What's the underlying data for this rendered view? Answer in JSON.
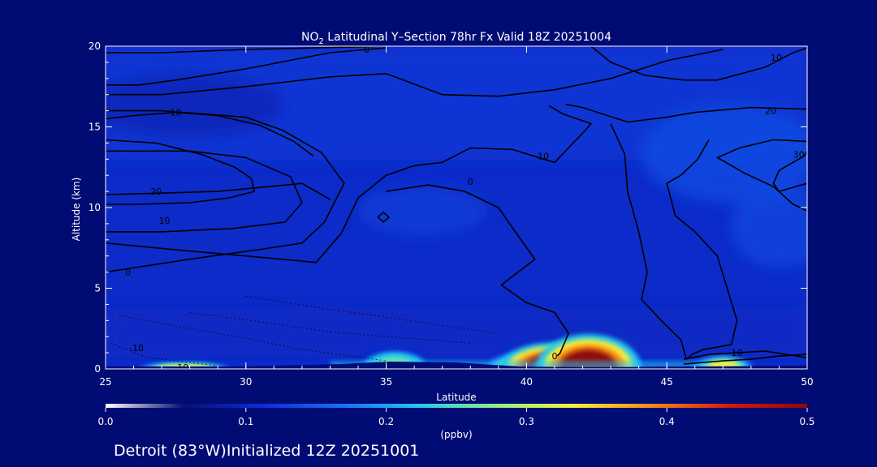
{
  "chart_data": {
    "type": "heatmap",
    "title_prefix": "NO",
    "title_subscript": "2",
    "title_suffix": " Latitudinal Y–Section 78hr  Fx Valid 18Z 20251004",
    "xlabel": "Latitude",
    "ylabel": "Altitude (km)",
    "xlim": [
      25,
      50
    ],
    "ylim": [
      0,
      20
    ],
    "x_ticks": [
      "25",
      "30",
      "35",
      "40",
      "45",
      "50"
    ],
    "y_ticks": [
      "0",
      "5",
      "10",
      "15",
      "20"
    ],
    "colorbar": {
      "label": "(ppbv)",
      "range": [
        0.0,
        0.5
      ],
      "ticks": [
        "0.0",
        "0.1",
        "0.2",
        "0.3",
        "0.4",
        "0.5"
      ],
      "colors": [
        "#ffffff",
        "#08106e",
        "#0c2bd6",
        "#1a6cf5",
        "#23c6f0",
        "#8cf08a",
        "#f7f03a",
        "#f58a17",
        "#d41a0c",
        "#8e0808"
      ]
    },
    "high_concentration_regions": [
      {
        "lat_center": 27.8,
        "lat_halfwidth": 1.2,
        "alt_top_km": 0.3,
        "peak_ppbv": 0.35
      },
      {
        "lat_center": 35.3,
        "lat_halfwidth": 1.0,
        "alt_top_km": 0.9,
        "peak_ppbv": 0.3
      },
      {
        "lat_center": 39.6,
        "lat_halfwidth": 0.9,
        "alt_top_km": 0.8,
        "peak_ppbv": 0.25
      },
      {
        "lat_center": 40.9,
        "lat_halfwidth": 1.4,
        "alt_top_km": 1.2,
        "peak_ppbv": 0.5
      },
      {
        "lat_center": 42.2,
        "lat_halfwidth": 1.4,
        "alt_top_km": 1.6,
        "peak_ppbv": 0.5
      },
      {
        "lat_center": 47.0,
        "lat_halfwidth": 0.8,
        "alt_top_km": 0.6,
        "peak_ppbv": 0.35
      }
    ],
    "contours": [
      {
        "points": [
          [
            25,
            19.6
          ],
          [
            27,
            19.6
          ],
          [
            30,
            19.8
          ],
          [
            35,
            20
          ]
        ]
      },
      {
        "points": [
          [
            25,
            17.6
          ],
          [
            26.2,
            17.6
          ],
          [
            27.5,
            17.9
          ],
          [
            30,
            18.6
          ],
          [
            33,
            19.6
          ],
          [
            35,
            19.9
          ]
        ]
      },
      {
        "points": [
          [
            25,
            17.0
          ],
          [
            27,
            17.0
          ],
          [
            30,
            17.5
          ],
          [
            33,
            18.1
          ],
          [
            35,
            18.3
          ],
          [
            37,
            17.0
          ],
          [
            39,
            16.9
          ],
          [
            41,
            17.3
          ],
          [
            43,
            18.0
          ],
          [
            45,
            19.1
          ],
          [
            47,
            19.8
          ]
        ]
      },
      {
        "points": [
          [
            25,
            15.5
          ],
          [
            26,
            15.7
          ],
          [
            27.5,
            15.9
          ],
          [
            29,
            15.7
          ],
          [
            30.5,
            15.1
          ],
          [
            31.7,
            14.1
          ],
          [
            32.4,
            13.2
          ]
        ]
      },
      {
        "points": [
          [
            25,
            14.2
          ],
          [
            26.8,
            14.0
          ],
          [
            28.4,
            13.3
          ],
          [
            29.6,
            12.5
          ],
          [
            30.2,
            11.8
          ],
          [
            30.3,
            11.0
          ],
          [
            29.4,
            10.6
          ],
          [
            28,
            10.3
          ],
          [
            26.2,
            10.2
          ],
          [
            25,
            10.2
          ]
        ]
      },
      {
        "points": [
          [
            25,
            13.5
          ],
          [
            28,
            13.5
          ],
          [
            30,
            13.1
          ],
          [
            31.6,
            11.9
          ],
          [
            32,
            10.3
          ],
          [
            31.4,
            9.1
          ],
          [
            29.5,
            8.7
          ],
          [
            27,
            8.5
          ],
          [
            25,
            8.5
          ]
        ]
      },
      {
        "points": [
          [
            25,
            16.0
          ],
          [
            27,
            16.0
          ],
          [
            30,
            15.6
          ],
          [
            31.3,
            14.8
          ],
          [
            32.7,
            13.4
          ],
          [
            33.5,
            11.5
          ],
          [
            32.8,
            9.1
          ],
          [
            32,
            7.8
          ],
          [
            30.5,
            7.4
          ],
          [
            28,
            6.8
          ],
          [
            25,
            6.0
          ]
        ]
      },
      {
        "points": [
          [
            25,
            7.8
          ],
          [
            28,
            7.3
          ],
          [
            30,
            7.0
          ],
          [
            32.5,
            6.6
          ],
          [
            33.4,
            8.4
          ],
          [
            34.0,
            10.6
          ],
          [
            35.0,
            12.0
          ],
          [
            36.0,
            12.6
          ],
          [
            37.0,
            12.8
          ],
          [
            38.0,
            13.7
          ],
          [
            39.5,
            13.6
          ],
          [
            41.0,
            12.8
          ],
          [
            42.1,
            14.8
          ],
          [
            42.3,
            15.2
          ],
          [
            41.3,
            15.8
          ],
          [
            40.8,
            16.3
          ]
        ]
      },
      {
        "points": [
          [
            34.7,
            9.4
          ],
          [
            34.9,
            9.1
          ],
          [
            35.1,
            9.4
          ],
          [
            34.9,
            9.7
          ],
          [
            34.7,
            9.4
          ]
        ]
      },
      {
        "points": [
          [
            35,
            11.0
          ],
          [
            36.5,
            11.4
          ],
          [
            37.8,
            11.0
          ],
          [
            39.0,
            10.0
          ],
          [
            39.6,
            8.5
          ],
          [
            40.3,
            6.8
          ],
          [
            39.1,
            5.2
          ],
          [
            40.0,
            4.1
          ],
          [
            41.0,
            3.5
          ],
          [
            41.5,
            2.2
          ],
          [
            41.2,
            1.0
          ],
          [
            41.1,
            0.8
          ]
        ]
      },
      {
        "points": [
          [
            42.3,
            20.0
          ],
          [
            43.0,
            19.0
          ],
          [
            44.2,
            18.2
          ],
          [
            45.6,
            17.9
          ],
          [
            46.8,
            17.9
          ],
          [
            48.5,
            18.7
          ],
          [
            49.5,
            19.6
          ],
          [
            50,
            19.9
          ]
        ]
      },
      {
        "points": [
          [
            43,
            15.2
          ],
          [
            43.5,
            13.3
          ],
          [
            43.6,
            11.0
          ],
          [
            44.0,
            8.5
          ],
          [
            44.3,
            6.0
          ],
          [
            44.1,
            4.3
          ],
          [
            44.8,
            3.0
          ],
          [
            45.5,
            1.8
          ],
          [
            45.7,
            0.6
          ]
        ]
      },
      {
        "points": [
          [
            41.4,
            16.4
          ],
          [
            42.0,
            16.2
          ],
          [
            43.6,
            15.3
          ],
          [
            45.0,
            15.6
          ],
          [
            46.0,
            15.9
          ],
          [
            48.0,
            16.2
          ],
          [
            50,
            16.1
          ]
        ]
      },
      {
        "points": [
          [
            46.5,
            14.2
          ],
          [
            46.1,
            13.0
          ],
          [
            45.5,
            12.0
          ],
          [
            45.0,
            11.5
          ],
          [
            45.3,
            9.5
          ],
          [
            46.0,
            8.5
          ],
          [
            46.8,
            7.0
          ],
          [
            47.5,
            3.0
          ],
          [
            47.3,
            1.5
          ],
          [
            46.3,
            1.2
          ],
          [
            45.9,
            0.9
          ],
          [
            45.7,
            0.6
          ]
        ]
      },
      {
        "points": [
          [
            50,
            14.1
          ],
          [
            48.8,
            14.2
          ],
          [
            47.6,
            13.7
          ],
          [
            46.8,
            13.1
          ],
          [
            47.8,
            12.1
          ],
          [
            48.8,
            11.3
          ],
          [
            49.5,
            10.2
          ],
          [
            50,
            9.8
          ]
        ]
      },
      {
        "points": [
          [
            50,
            11.5
          ],
          [
            49.0,
            11.0
          ],
          [
            48.8,
            11.5
          ],
          [
            49.0,
            12.3
          ],
          [
            49.9,
            13.2
          ],
          [
            50,
            13.5
          ]
        ]
      },
      {
        "points": [
          [
            25,
            10.8
          ],
          [
            29,
            11.0
          ],
          [
            32,
            11.5
          ],
          [
            33,
            10.5
          ]
        ]
      },
      {
        "points": [
          [
            45.6,
            0.6
          ],
          [
            46.5,
            0.9
          ],
          [
            47.5,
            1.0
          ],
          [
            48.5,
            1.1
          ],
          [
            50,
            0.7
          ]
        ]
      },
      {
        "points": [
          [
            45.6,
            0.3
          ],
          [
            47,
            0.5
          ],
          [
            48,
            0.6
          ],
          [
            49,
            0.8
          ],
          [
            50,
            0.9
          ]
        ]
      }
    ],
    "contour_labels": [
      {
        "x": 34.3,
        "y": 19.8,
        "text": "0"
      },
      {
        "x": 48.9,
        "y": 19.3,
        "text": "10"
      },
      {
        "x": 27.5,
        "y": 15.9,
        "text": "10"
      },
      {
        "x": 48.7,
        "y": 16.0,
        "text": "20"
      },
      {
        "x": 49.7,
        "y": 13.3,
        "text": "30"
      },
      {
        "x": 26.8,
        "y": 11.0,
        "text": "20"
      },
      {
        "x": 27.1,
        "y": 9.2,
        "text": "10"
      },
      {
        "x": 38.0,
        "y": 11.6,
        "text": "0"
      },
      {
        "x": 40.6,
        "y": 13.2,
        "text": "10"
      },
      {
        "x": 25.8,
        "y": 6.0,
        "text": "0"
      },
      {
        "x": 26.1,
        "y": 1.3,
        "text": "-10"
      },
      {
        "x": 27.7,
        "y": 0.1,
        "text": "-10"
      },
      {
        "x": 47.5,
        "y": 1.0,
        "text": "10"
      },
      {
        "x": 41.0,
        "y": 0.8,
        "text": "0"
      }
    ],
    "dashed_contours": [
      {
        "points": [
          [
            25.2,
            1.6
          ],
          [
            26.5,
            0.7
          ],
          [
            28.0,
            0.4
          ],
          [
            29.0,
            0.2
          ]
        ]
      },
      {
        "points": [
          [
            25.5,
            3.3
          ],
          [
            28.0,
            2.5
          ],
          [
            30.0,
            1.9
          ],
          [
            32.0,
            1.2
          ],
          [
            35.0,
            0.5
          ]
        ]
      },
      {
        "points": [
          [
            28.0,
            3.5
          ],
          [
            31.0,
            2.8
          ],
          [
            33.0,
            2.3
          ],
          [
            35.0,
            2.0
          ],
          [
            38.0,
            1.6
          ]
        ]
      },
      {
        "points": [
          [
            30.0,
            4.5
          ],
          [
            33.0,
            3.7
          ],
          [
            35.0,
            3.2
          ],
          [
            37.0,
            2.7
          ],
          [
            39.0,
            2.2
          ]
        ]
      }
    ]
  },
  "footer": {
    "location_text": "Detroit (83°W)Initialized 12Z 20251001"
  }
}
